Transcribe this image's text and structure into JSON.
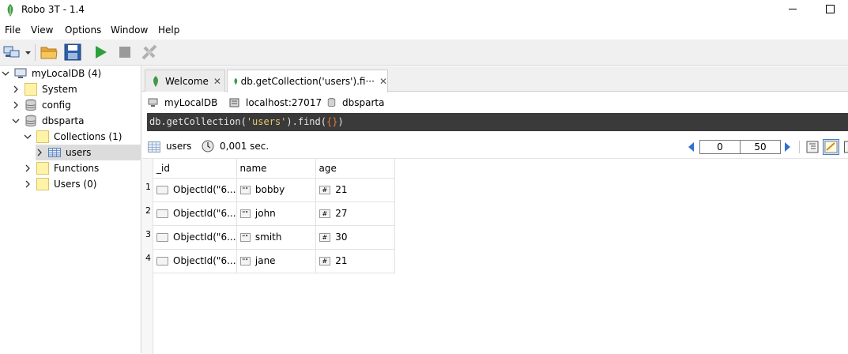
{
  "window": {
    "title": "Robo 3T - 1.4"
  },
  "menu": [
    "File",
    "View",
    "Options",
    "Window",
    "Help"
  ],
  "tree": {
    "root": "myLocalDB (4)",
    "items": [
      {
        "label": "System"
      },
      {
        "label": "config"
      },
      {
        "label": "dbsparta"
      },
      {
        "label": "Collections (1)"
      },
      {
        "label": "users"
      },
      {
        "label": "Functions"
      },
      {
        "label": "Users (0)"
      }
    ]
  },
  "tabs": [
    {
      "label": "Welcome"
    },
    {
      "label": "db.getCollection('users').fi···"
    }
  ],
  "connection": {
    "db_server": "myLocalDB",
    "host": "localhost:27017",
    "database": "dbsparta"
  },
  "query": {
    "prefix": "db.getCollection(",
    "arg": "'users'",
    "mid": ").find(",
    "braces": "{}",
    "suffix": ")"
  },
  "results": {
    "collection": "users",
    "time": "0,001 sec.",
    "page_start": "0",
    "page_size": "50",
    "columns": [
      "_id",
      "name",
      "age"
    ],
    "rows": [
      {
        "n": "1",
        "id": "ObjectId(\"6...",
        "name": "bobby",
        "age": "21"
      },
      {
        "n": "2",
        "id": "ObjectId(\"6...",
        "name": "john",
        "age": "27"
      },
      {
        "n": "3",
        "id": "ObjectId(\"6...",
        "name": "smith",
        "age": "30"
      },
      {
        "n": "4",
        "id": "ObjectId(\"6...",
        "name": "jane",
        "age": "21"
      }
    ],
    "string_type_icon": "\"\"",
    "int_type_icon": "#"
  },
  "colors": {
    "query_bg": "#3a3a3a",
    "query_string": "#e9c96b",
    "query_brace": "#e07b39",
    "accent_green": "#2e9e3e",
    "pager_arrow": "#2f6fd6"
  }
}
